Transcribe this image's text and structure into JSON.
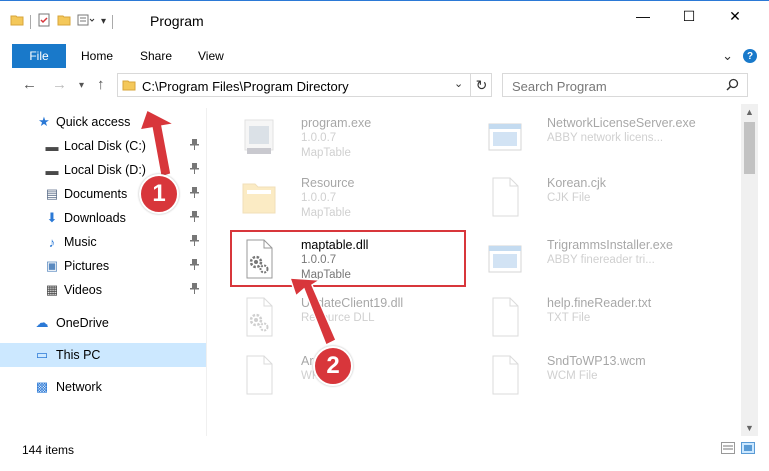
{
  "window": {
    "title": "Program",
    "minimize": "—",
    "maximize": "☐",
    "close": "✕"
  },
  "ribbon": {
    "tabs": [
      "File",
      "Home",
      "Share",
      "View"
    ],
    "expand": "⌄",
    "help": "?"
  },
  "address": {
    "path": "C:\\Program Files\\Program Directory",
    "chevron": "⌄",
    "refresh": "↻"
  },
  "search": {
    "placeholder": "Search Program",
    "icon": "⌕"
  },
  "sidebar": {
    "items": [
      {
        "label": "Quick access",
        "icon": "star-icon",
        "glyph": "★",
        "color": "#2b79d6",
        "pinned": false
      },
      {
        "label": "Local Disk (C:)",
        "icon": "drive-icon",
        "glyph": "▬",
        "color": "#4a4a4a",
        "pinned": true
      },
      {
        "label": "Local Disk (D:)",
        "icon": "drive-icon",
        "glyph": "▬",
        "color": "#4a4a4a",
        "pinned": true
      },
      {
        "label": "Documents",
        "icon": "documents-icon",
        "glyph": "▤",
        "color": "#5a6d88",
        "pinned": true
      },
      {
        "label": "Downloads",
        "icon": "download-icon",
        "glyph": "⬇",
        "color": "#2b79d6",
        "pinned": true
      },
      {
        "label": "Music",
        "icon": "music-icon",
        "glyph": "♪",
        "color": "#2b79d6",
        "pinned": true
      },
      {
        "label": "Pictures",
        "icon": "pictures-icon",
        "glyph": "▣",
        "color": "#5a8ac0",
        "pinned": true
      },
      {
        "label": "Videos",
        "icon": "videos-icon",
        "glyph": "▦",
        "color": "#444444",
        "pinned": true
      },
      {
        "label": "OneDrive",
        "icon": "cloud-icon",
        "glyph": "☁",
        "color": "#2b79d6",
        "pinned": false
      },
      {
        "label": "This PC",
        "icon": "computer-icon",
        "glyph": "▭",
        "color": "#2b79d6",
        "pinned": false
      },
      {
        "label": "Network",
        "icon": "network-icon",
        "glyph": "▩",
        "color": "#2b79d6",
        "pinned": false
      }
    ],
    "pin_glyph": "📌"
  },
  "files": [
    {
      "name": "program.exe",
      "line1": "1.0.0.7",
      "line2": "MapTable",
      "icon": "exe-icon"
    },
    {
      "name": "NetworkLicenseServer.exe",
      "line1": "ABBY network licens...",
      "line2": "",
      "icon": "exe-window-icon"
    },
    {
      "name": "Resource",
      "line1": "1.0.0.7",
      "line2": "MapTable",
      "icon": "folder-icon"
    },
    {
      "name": "Korean.cjk",
      "line1": "CJK File",
      "line2": "",
      "icon": "blank-file-icon"
    },
    {
      "name": "maptable.dll",
      "line1": "1.0.0.7",
      "line2": "MapTable",
      "icon": "dll-gear-icon"
    },
    {
      "name": "TrigrammsInstaller.exe",
      "line1": "ABBY finereader tri...",
      "line2": "",
      "icon": "exe-window-icon"
    },
    {
      "name": "UpdateClient19.dll",
      "line1": "Resource DLL",
      "line2": "",
      "icon": "dll-gear-icon"
    },
    {
      "name": "help.fineReader.txt",
      "line1": "TXT File",
      "line2": "",
      "icon": "blank-file-icon"
    },
    {
      "name": "Arabic",
      "line1": "WRD File",
      "line2": "",
      "icon": "blank-file-icon"
    },
    {
      "name": "SndToWP13.wcm",
      "line1": "WCM File",
      "line2": "",
      "icon": "blank-file-icon"
    }
  ],
  "status": {
    "item_count": "144 items"
  },
  "annotations": {
    "marker1": "1",
    "marker2": "2"
  },
  "colors": {
    "accent": "#1979ca",
    "highlight": "#d8363b",
    "selected_bg": "#cce8ff"
  }
}
